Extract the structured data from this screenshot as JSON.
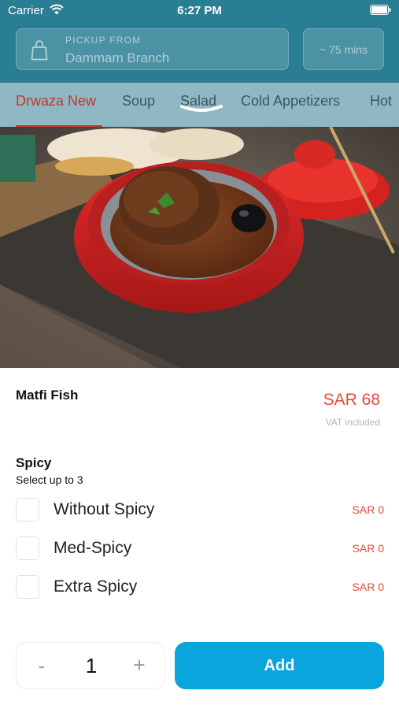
{
  "status_bar": {
    "carrier": "Carrier",
    "time": "6:27 PM",
    "wifi_icon": "wifi-icon",
    "battery_icon": "battery-icon"
  },
  "header": {
    "pickup_label": "PICKUP FROM",
    "branch": "Dammam Branch",
    "eta": "~ 75 mins",
    "bag_icon": "shopping-bag-icon",
    "background_color": "#2a7e94"
  },
  "tabs": [
    {
      "label": "Drwaza New",
      "active": true
    },
    {
      "label": "Soup",
      "active": false
    },
    {
      "label": "Salad",
      "active": false
    },
    {
      "label": "Cold Appetizers",
      "active": false
    },
    {
      "label": "Hot",
      "active": false
    }
  ],
  "product": {
    "name": "Matfi Fish",
    "price": "SAR 68",
    "vat_note": "VAT included"
  },
  "option_group": {
    "title": "Spicy",
    "subtitle": "Select up to 3",
    "options": [
      {
        "label": "Without Spicy",
        "price": "SAR 0",
        "checked": false
      },
      {
        "label": "Med-Spicy",
        "price": "SAR 0",
        "checked": false
      },
      {
        "label": "Extra Spicy",
        "price": "SAR 0",
        "checked": false
      }
    ]
  },
  "quantity": {
    "minus": "-",
    "value": "1",
    "plus": "+"
  },
  "add_button": {
    "label": "Add",
    "color": "#0ba5dd"
  },
  "colors": {
    "accent_red": "#e34a3a",
    "tab_active": "#c0392b"
  }
}
